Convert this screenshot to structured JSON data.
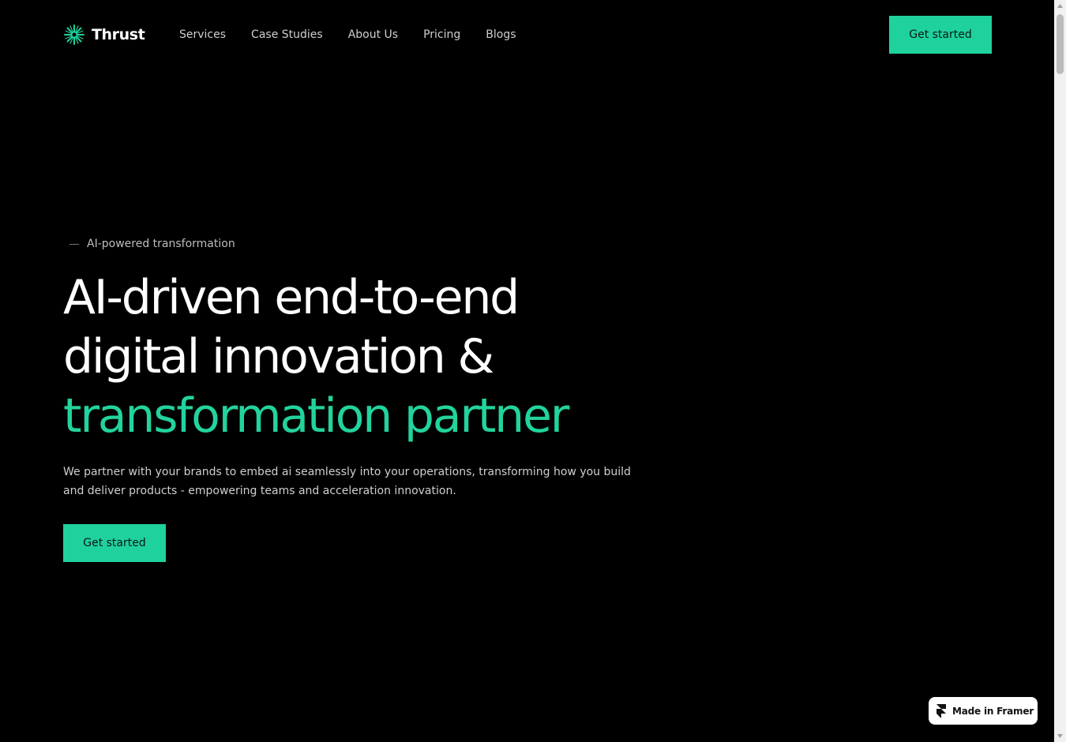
{
  "brand": {
    "name": "Thrust",
    "icon": "sparkle-asterisk-icon",
    "accent_color": "#1fd19d"
  },
  "nav": {
    "items": [
      {
        "label": "Services"
      },
      {
        "label": "Case Studies"
      },
      {
        "label": "About Us"
      },
      {
        "label": "Pricing"
      },
      {
        "label": "Blogs"
      }
    ],
    "cta_label": "Get started"
  },
  "hero": {
    "eyebrow": "AI-powered transformation",
    "headline_line1": "AI-driven end-to-end",
    "headline_line2": "digital innovation &",
    "headline_line3_accent": "transformation partner",
    "subtitle": "We partner with your brands to embed ai seamlessly into your operations, transforming how you build and deliver products - empowering teams and acceleration innovation.",
    "cta_label": "Get started"
  },
  "badge": {
    "label": "Made in Framer",
    "icon": "framer-logo-icon"
  },
  "colors": {
    "background": "#000000",
    "accent": "#1fd19d",
    "text": "#ffffff",
    "muted": "#cfcfcf"
  }
}
